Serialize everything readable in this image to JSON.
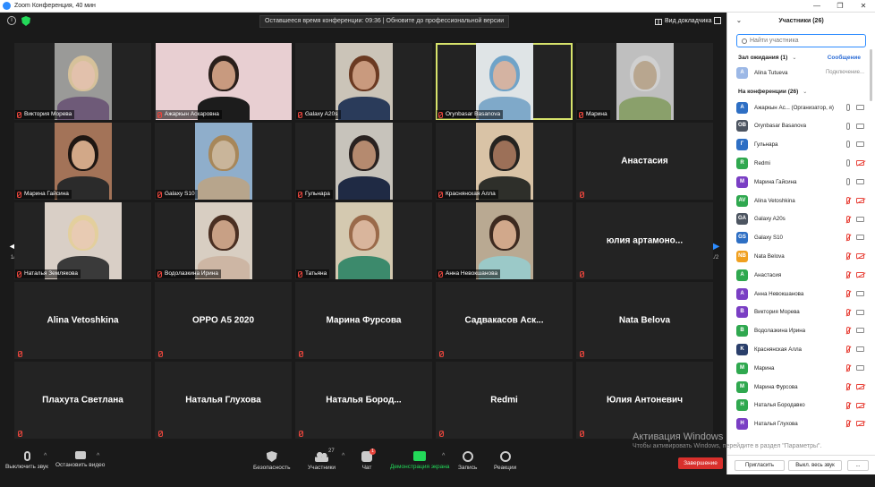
{
  "window": {
    "title": "Zoom Конференция, 40 мин",
    "controls": [
      "—",
      "❐",
      "✕"
    ]
  },
  "topbar": {
    "time_banner": "Оставшееся время конференции: 09:36 | Обновите до профессиональной версии",
    "view_label": "Вид докладчика"
  },
  "pager": {
    "left": "1/2",
    "right": "1/2"
  },
  "tiles": [
    {
      "name": "Виктория Морева",
      "video": true,
      "active": false
    },
    {
      "name": "Ажаркын Аскаровна",
      "video": true,
      "active": false
    },
    {
      "name": "Galaxy A20s",
      "video": true,
      "active": false
    },
    {
      "name": "Orynbasar Basanova",
      "video": true,
      "active": true
    },
    {
      "name": "Марина",
      "video": true,
      "active": false
    },
    {
      "name": "Марина Гайсина",
      "video": true,
      "active": false
    },
    {
      "name": "Galaxy S10",
      "video": true,
      "active": false
    },
    {
      "name": "Гульнара",
      "video": true,
      "active": false
    },
    {
      "name": "Краснянская Алла",
      "video": true,
      "active": false
    },
    {
      "name": "Анастасия",
      "video": false,
      "active": false
    },
    {
      "name": "Наталья Землякова",
      "video": true,
      "active": false
    },
    {
      "name": "Водолазкина Ирина",
      "video": true,
      "active": false
    },
    {
      "name": "Татьяна",
      "video": true,
      "active": false
    },
    {
      "name": "Анна Невокшанова",
      "video": true,
      "active": false
    },
    {
      "name": "юлия  артамоно...",
      "video": false,
      "active": false
    },
    {
      "name": "Alina Vetoshkina",
      "video": false,
      "active": false
    },
    {
      "name": "OPPO A5 2020",
      "video": false,
      "active": false
    },
    {
      "name": "Марина Фурсова",
      "video": false,
      "active": false
    },
    {
      "name": "Садвакасов  Аск...",
      "video": false,
      "active": false
    },
    {
      "name": "Nata Belova",
      "video": false,
      "active": false
    },
    {
      "name": "Плахута Светлана",
      "video": false,
      "active": false
    },
    {
      "name": "Наталья Глухова",
      "video": false,
      "active": false
    },
    {
      "name": "Наталья  Бород...",
      "video": false,
      "active": false
    },
    {
      "name": "Redmi",
      "video": false,
      "active": false
    },
    {
      "name": "Юлия Антоневич",
      "video": false,
      "active": false
    }
  ],
  "toolbar": {
    "mute": "Выключить звук",
    "stop_video": "Остановить видео",
    "security": "Безопасность",
    "participants": "Участники",
    "participants_count": "27",
    "chat": "Чат",
    "chat_badge": "1",
    "share": "Демонстрация экрана",
    "record": "Запись",
    "reactions": "Реакции",
    "end": "Завершение"
  },
  "watermark": {
    "line1": "Активация Windows",
    "line2": "Чтобы активировать Windows, перейдите в раздел \"Параметры\"."
  },
  "panel": {
    "title": "Участники (26)",
    "search_placeholder": "Найти участника",
    "waiting_label": "Зал ожидания (1)",
    "waiting_action": "Сообщение",
    "waiting": [
      {
        "initials": "A",
        "name": "Alina Tutueva",
        "status": "Подключение...",
        "color": "#9cb8e6"
      }
    ],
    "in_meeting_label": "На конференции (26)",
    "participants": [
      {
        "initials": "A",
        "name": "Ажаркын Ас... (Организатор, я)",
        "color": "#2e6fc4",
        "mic": "on",
        "cam": "on"
      },
      {
        "initials": "OB",
        "name": "Orynbasar Basanova",
        "color": "#4d5561",
        "mic": "on",
        "cam": "on"
      },
      {
        "initials": "Г",
        "name": "Гульнара",
        "color": "#2e6fc4",
        "mic": "on",
        "cam": "on"
      },
      {
        "initials": "R",
        "name": "Redmi",
        "color": "#2fa84f",
        "mic": "on",
        "cam": "off"
      },
      {
        "initials": "M",
        "name": "Марина Гайсина",
        "color": "#7a3fc4",
        "mic": "on",
        "cam": "on"
      },
      {
        "initials": "AV",
        "name": "Alina Vetoshkina",
        "color": "#2fa84f",
        "mic": "off",
        "cam": "off"
      },
      {
        "initials": "GA",
        "name": "Galaxy A20s",
        "color": "#4d5561",
        "mic": "off",
        "cam": "on"
      },
      {
        "initials": "GS",
        "name": "Galaxy S10",
        "color": "#2e6fc4",
        "mic": "off",
        "cam": "on"
      },
      {
        "initials": "NB",
        "name": "Nata Belova",
        "color": "#f0a020",
        "mic": "off",
        "cam": "off"
      },
      {
        "initials": "A",
        "name": "Анастасия",
        "color": "#2fa84f",
        "mic": "off",
        "cam": "off"
      },
      {
        "initials": "A",
        "name": "Анна Невокшанова",
        "color": "#7a3fc4",
        "mic": "off",
        "cam": "on"
      },
      {
        "initials": "B",
        "name": "Виктория Морева",
        "color": "#7a3fc4",
        "mic": "off",
        "cam": "on"
      },
      {
        "initials": "B",
        "name": "Водолазкина Ирина",
        "color": "#2fa84f",
        "mic": "off",
        "cam": "on"
      },
      {
        "initials": "K",
        "name": "Краснянская Алла",
        "color": "#2a3f6b",
        "mic": "off",
        "cam": "on"
      },
      {
        "initials": "M",
        "name": "Марина",
        "color": "#2fa84f",
        "mic": "off",
        "cam": "on"
      },
      {
        "initials": "M",
        "name": "Марина Фурсова",
        "color": "#2fa84f",
        "mic": "off",
        "cam": "off"
      },
      {
        "initials": "H",
        "name": "Наталья Бородавко",
        "color": "#2fa84f",
        "mic": "off",
        "cam": "off"
      },
      {
        "initials": "H",
        "name": "Наталья Глухова",
        "color": "#7a3fc4",
        "mic": "off",
        "cam": "off"
      }
    ],
    "invite": "Пригласить",
    "mute_all": "Выкл. весь звук",
    "more": "..."
  }
}
